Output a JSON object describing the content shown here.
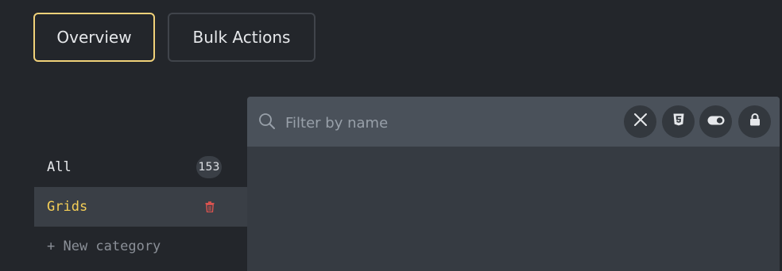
{
  "tabs": [
    {
      "label": "Overview",
      "active": true
    },
    {
      "label": "Bulk Actions",
      "active": false
    }
  ],
  "sidebar": {
    "categories": [
      {
        "label": "All",
        "count": "153"
      },
      {
        "label": "Grids",
        "active": true,
        "icon": "trash-icon"
      }
    ],
    "new_category_label": "+ New category"
  },
  "filter": {
    "placeholder": "Filter by name",
    "value": "",
    "buttons": [
      "close-icon",
      "css3-icon",
      "toggle-icon",
      "lock-icon"
    ]
  },
  "colors": {
    "accent": "#f0d179",
    "active_text": "#f5cf57",
    "trash": "#d9534f",
    "background": "#23262b",
    "panel": "#363b42",
    "filter_bar": "#4a515a"
  }
}
